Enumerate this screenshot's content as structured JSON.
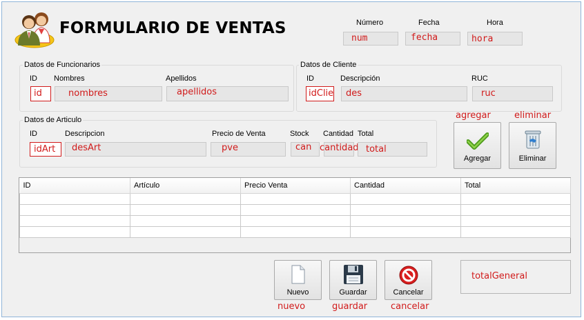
{
  "header": {
    "title": "FORMULARIO DE VENTAS",
    "numero_label": "Número",
    "fecha_label": "Fecha",
    "hora_label": "Hora",
    "numero_value": "num",
    "fecha_value": "fecha",
    "hora_value": "hora"
  },
  "funcionarios": {
    "group_title": "Datos de Funcionarios",
    "id_label": "ID",
    "nombres_label": "Nombres",
    "apellidos_label": "Apellidos",
    "id_value": "id",
    "nombres_value": "nombres",
    "apellidos_value": "apellidos"
  },
  "cliente": {
    "group_title": "Datos de Cliente",
    "id_label": "ID",
    "descripcion_label": "Descripción",
    "ruc_label": "RUC",
    "id_value": "idClie",
    "descripcion_value": "des",
    "ruc_value": "ruc"
  },
  "articulo": {
    "group_title": "Datos de Articulo",
    "id_label": "ID",
    "descripcion_label": "Descripcion",
    "precio_label": "Precio de Venta",
    "stock_label": "Stock",
    "cantidad_label": "Cantidad",
    "total_label": "Total",
    "id_value": "idArt",
    "descripcion_value": "desArt",
    "precio_value": "pve",
    "stock_value": "can",
    "cantidad_value": "cantidad",
    "total_value": "total"
  },
  "actions": {
    "agregar_name": "agregar",
    "eliminar_name": "eliminar",
    "agregar_label": "Agregar",
    "eliminar_label": "Eliminar"
  },
  "table": {
    "columns": [
      "ID",
      "Artículo",
      "Precio Venta",
      "Cantidad",
      "Total"
    ],
    "rows": 4
  },
  "footer": {
    "nuevo_label": "Nuevo",
    "guardar_label": "Guardar",
    "cancelar_label": "Cancelar",
    "nuevo_name": "nuevo",
    "guardar_name": "guardar",
    "cancelar_name": "cancelar",
    "total_general": "totalGeneral"
  },
  "colors": {
    "variable_text": "#d11a1a",
    "window_bg": "#f0f0f0",
    "window_border": "#8fb4d8"
  },
  "icons": {
    "logo": "users-icon",
    "agregar": "checkmark-icon",
    "eliminar": "trash-icon",
    "nuevo": "document-icon",
    "guardar": "floppy-disk-icon",
    "cancelar": "cancel-icon"
  }
}
